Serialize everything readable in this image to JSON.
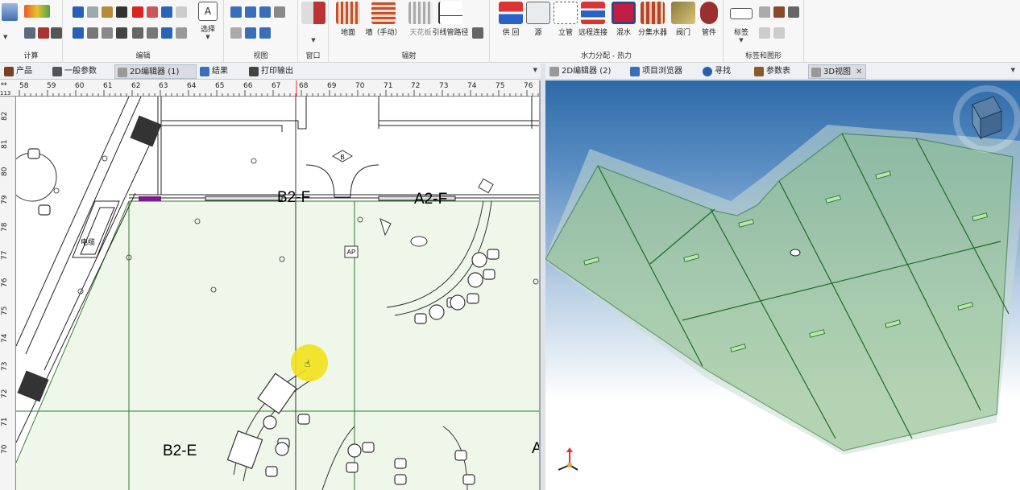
{
  "ribbon": {
    "groups": [
      {
        "label": "计算"
      },
      {
        "label": "编辑",
        "select_label": "选择"
      },
      {
        "label": "视图"
      },
      {
        "label": "窗口"
      },
      {
        "label": "辐射",
        "buttons": [
          "地面",
          "墙（手动）",
          "天花板",
          "引线管路径"
        ]
      },
      {
        "label": "水力分配 - 热力",
        "buttons": [
          "供 回",
          "源",
          "立管",
          "远程连接",
          "混水",
          "分集水器",
          "阀门",
          "管件"
        ]
      },
      {
        "label": "标签和图形",
        "buttons": [
          "标签"
        ]
      }
    ]
  },
  "left_tabs": [
    {
      "label": "产品"
    },
    {
      "label": "一般参数"
    },
    {
      "label": "2D编辑器 (1)"
    },
    {
      "label": "结果"
    },
    {
      "label": "打印输出"
    }
  ],
  "right_tabs": [
    {
      "label": "2D编辑器 (2)"
    },
    {
      "label": "项目浏览器"
    },
    {
      "label": "寻找"
    },
    {
      "label": "参数表"
    },
    {
      "label": "3D视图"
    }
  ],
  "ruler": {
    "top": [
      "58",
      "59",
      "60",
      "61",
      "62",
      "63",
      "64",
      "65",
      "66",
      "67",
      "68",
      "69",
      "70",
      "71",
      "72",
      "73",
      "74",
      "75",
      "76"
    ],
    "left": [
      "82",
      "81",
      "80",
      "79",
      "78",
      "77",
      "76",
      "75",
      "74",
      "73",
      "72",
      "71",
      "70"
    ],
    "corner": "113"
  },
  "plan_labels": {
    "room1": "B2-F",
    "room2": "A2-F",
    "room3": "B2-E",
    "room4": "A",
    "cable": "电缆",
    "tag_b": "B",
    "tag_ap": "AP"
  },
  "colors": {
    "zone_fill": "#eef7e9",
    "zone_line": "#2d7a2d",
    "cursor": "#f2e11a",
    "panel_green": "#8fc08a"
  }
}
